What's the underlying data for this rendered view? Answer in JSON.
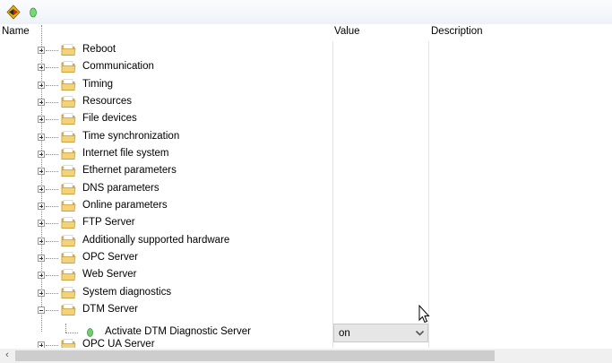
{
  "toolbar": {
    "buttons": [
      {
        "name": "navigate-icon"
      },
      {
        "name": "dtm-green-icon"
      }
    ]
  },
  "columns": {
    "name": "Name",
    "value": "Value",
    "description": "Description"
  },
  "tree": {
    "items": [
      {
        "label": "Reboot",
        "expanded": false
      },
      {
        "label": "Communication",
        "expanded": false
      },
      {
        "label": "Timing",
        "expanded": false
      },
      {
        "label": "Resources",
        "expanded": false
      },
      {
        "label": "File devices",
        "expanded": false
      },
      {
        "label": "Time synchronization",
        "expanded": false
      },
      {
        "label": "Internet file system",
        "expanded": false
      },
      {
        "label": "Ethernet parameters",
        "expanded": false
      },
      {
        "label": "DNS parameters",
        "expanded": false
      },
      {
        "label": "Online parameters",
        "expanded": false
      },
      {
        "label": "FTP Server",
        "expanded": false
      },
      {
        "label": "Additionally supported hardware",
        "expanded": false
      },
      {
        "label": "OPC Server",
        "expanded": false
      },
      {
        "label": "Web Server",
        "expanded": false
      },
      {
        "label": "System diagnostics",
        "expanded": false
      },
      {
        "label": "DTM Server",
        "expanded": true
      },
      {
        "label": "OPC UA Server",
        "expanded": false
      }
    ],
    "child": {
      "label": "Activate DTM Diagnostic Server",
      "value": "on"
    }
  },
  "colors": {
    "folder": "#f4d27a",
    "leaf_icon": "#4caf50",
    "grid_line": "#e4e4e4",
    "combo_bg": "#e6e6e6"
  }
}
